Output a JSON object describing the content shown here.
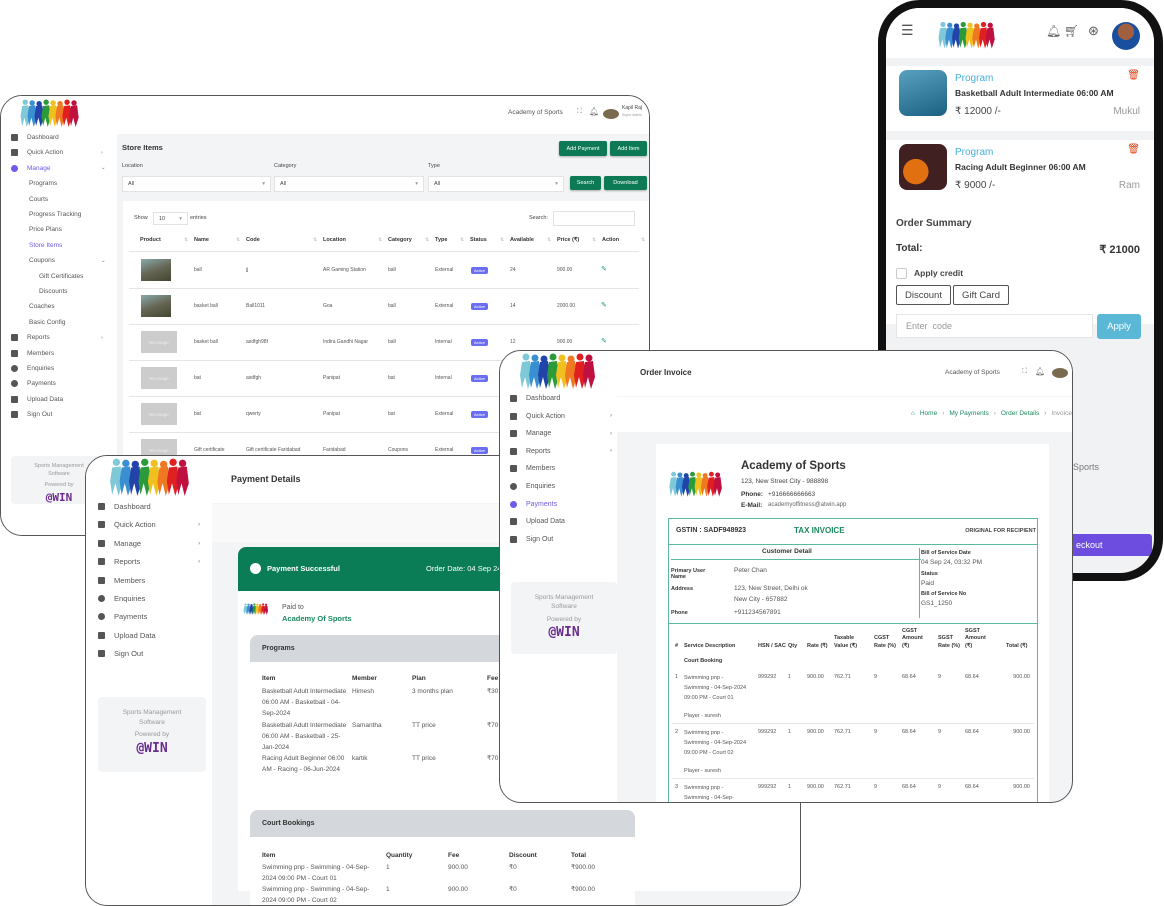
{
  "colors": {
    "brand_green": "#0d7a55",
    "accent_purple": "#6c5ce7",
    "teal": "#4fb3a0",
    "apply_blue": "#5bb7d6",
    "delete_red": "#e0451b"
  },
  "store_window": {
    "org_selector": "Academy of Sports",
    "user_name": "Kapil Raj",
    "user_role": "Super Admin",
    "sidebar": [
      {
        "label": "Dashboard",
        "icon": "dashboard-icon"
      },
      {
        "label": "Quick Action",
        "icon": "bolt-icon",
        "chevron": ">"
      },
      {
        "label": "Manage",
        "icon": "gear-icon",
        "chevron": "v",
        "active": true
      },
      {
        "label": "Programs",
        "sub": 1
      },
      {
        "label": "Courts",
        "sub": 1
      },
      {
        "label": "Progress Tracking",
        "sub": 1
      },
      {
        "label": "Price Plans",
        "sub": 1
      },
      {
        "label": "Store Items",
        "sub": 1,
        "active": true
      },
      {
        "label": "Coupons",
        "sub": 1,
        "chevron": "v"
      },
      {
        "label": "Gift Certificates",
        "sub": 2
      },
      {
        "label": "Discounts",
        "sub": 2
      },
      {
        "label": "Coaches",
        "sub": 1
      },
      {
        "label": "Basic Config",
        "sub": 1
      },
      {
        "label": "Reports",
        "icon": "reports-icon",
        "chevron": ">"
      },
      {
        "label": "Members",
        "icon": "members-icon"
      },
      {
        "label": "Enquiries",
        "icon": "question-icon"
      },
      {
        "label": "Payments",
        "icon": "payments-icon"
      },
      {
        "label": "Upload Data",
        "icon": "database-icon"
      },
      {
        "label": "Sign Out",
        "icon": "sign-out-icon"
      }
    ],
    "footer": {
      "line1": "Sports Management",
      "line2": "Software",
      "powered": "Powered by",
      "brand": "@WIN"
    },
    "title": "Store Items",
    "add_payment": "Add Payment",
    "add_item": "Add Item",
    "filters": [
      {
        "label": "Location",
        "value": "All"
      },
      {
        "label": "Category",
        "value": "All"
      },
      {
        "label": "Type",
        "value": "All"
      }
    ],
    "search_btn": "Search",
    "download_btn": "Download",
    "show": "Show",
    "entries_value": "10",
    "entries": "entries",
    "search_label": "Search:",
    "columns": [
      "Product",
      "Name",
      "Code",
      "Location",
      "Category",
      "Type",
      "Status",
      "Available",
      "Price (₹)",
      "Action"
    ],
    "rows": [
      {
        "img": true,
        "name": "ball",
        "code": "jj",
        "location": "AR Gaming Station",
        "category": "ball",
        "type": "External",
        "status": "Active",
        "available": "24",
        "price": "900.00"
      },
      {
        "img": true,
        "name": "basket ball",
        "code": "Ball1011",
        "location": "Goa",
        "category": "ball",
        "type": "External",
        "status": "Active",
        "available": "14",
        "price": "2000.00"
      },
      {
        "img": false,
        "name": "basket ball",
        "code": "asdfgh98f",
        "location": "Indira Gandhi Nagar",
        "category": "ball",
        "type": "Internal",
        "status": "Active",
        "available": "12",
        "price": "900.00"
      },
      {
        "img": false,
        "name": "bat",
        "code": "asdfgh",
        "location": "Panipat",
        "category": "bat",
        "type": "Internal",
        "status": "Active",
        "available": "",
        "price": ""
      },
      {
        "img": false,
        "name": "bat",
        "code": "qwerty",
        "location": "Panipat",
        "category": "bat",
        "type": "External",
        "status": "Active",
        "available": "",
        "price": ""
      },
      {
        "img": false,
        "name": "Gift certificate",
        "code": "Gift certificate Faridabad",
        "location": "Faridabad",
        "category": "Coupons",
        "type": "External",
        "status": "Active",
        "available": "",
        "price": ""
      }
    ],
    "no_image": "No Image"
  },
  "phone": {
    "cart": [
      {
        "kind": "Program",
        "title": "Basketball Adult Intermediate 06:00 AM",
        "price": "₹ 12000 /-",
        "member": "Mukul"
      },
      {
        "kind": "Program",
        "title": "Racing Adult Beginner 06:00 AM",
        "price": "₹ 9000 /-",
        "member": "Ram"
      }
    ],
    "summary_title": "Order Summary",
    "total_label": "Total:",
    "total_value": "₹ 21000",
    "apply_credit": "Apply credit",
    "discount": "Discount",
    "gift_card": "Gift Card",
    "code_placeholder": "Enter  code",
    "apply": "Apply",
    "checkout": "eckout",
    "peek_text": "y Sports",
    "peek_text2": "d"
  },
  "payment_window": {
    "sidebar": [
      {
        "label": "Dashboard",
        "icon": "dashboard-icon"
      },
      {
        "label": "Quick Action",
        "icon": "bolt-icon",
        "chevron": ">"
      },
      {
        "label": "Manage",
        "icon": "gear-icon",
        "chevron": ">"
      },
      {
        "label": "Reports",
        "icon": "reports-icon",
        "chevron": ">"
      },
      {
        "label": "Members",
        "icon": "members-icon"
      },
      {
        "label": "Enquiries",
        "icon": "question-icon"
      },
      {
        "label": "Payments",
        "icon": "payments-icon"
      },
      {
        "label": "Upload Data",
        "icon": "database-icon"
      },
      {
        "label": "Sign Out",
        "icon": "sign-out-icon"
      }
    ],
    "title": "Payment Details",
    "banner": "Payment Successful",
    "order_date": "Order Date: 04 Sep 24",
    "paid_to": "Paid to",
    "paid_to_name": "Academy Of Sports",
    "programs_title": "Programs",
    "programs_cols": [
      "Item",
      "Member",
      "Plan",
      "Fee"
    ],
    "programs_rows": [
      [
        "Basketball Adult Intermediate 06:00 AM - Basketball - 04-Sep-2024",
        "Himesh",
        "3 months plan",
        "₹30"
      ],
      [
        "Basketball Adult Intermediate 06:00 AM - Basketball - 25-Jan-2024",
        "Samantha",
        "TT price",
        "₹70"
      ],
      [
        "Racing Adult Beginner 06:00 AM - Racing - 06-Jun-2024",
        "kartik",
        "TT price",
        "₹70"
      ]
    ],
    "court_title": "Court Bookings",
    "court_cols": [
      "Item",
      "Quantity",
      "Fee",
      "Discount",
      "Total"
    ],
    "court_rows": [
      [
        "Swimming pnp - Swimming - 04-Sep-2024 09:00 PM - Court 01",
        "1",
        "900.00",
        "₹0",
        "₹900.00"
      ],
      [
        "Swimming pnp - Swimming - 04-Sep-2024 09:00 PM - Court 02",
        "1",
        "900.00",
        "₹0",
        "₹900.00"
      ]
    ]
  },
  "invoice_window": {
    "sidebar": [
      {
        "label": "Dashboard",
        "icon": "dashboard-icon"
      },
      {
        "label": "Quick Action",
        "icon": "bolt-icon",
        "chevron": ">"
      },
      {
        "label": "Manage",
        "icon": "gear-icon",
        "chevron": ">"
      },
      {
        "label": "Reports",
        "icon": "reports-icon",
        "chevron": ">"
      },
      {
        "label": "Members",
        "icon": "members-icon"
      },
      {
        "label": "Enquiries",
        "icon": "question-icon"
      },
      {
        "label": "Payments",
        "icon": "payments-icon",
        "active": true
      },
      {
        "label": "Upload Data",
        "icon": "database-icon"
      },
      {
        "label": "Sign Out",
        "icon": "sign-out-icon"
      }
    ],
    "title": "Order Invoice",
    "org_selector": "Academy of Sports",
    "breadcrumb": [
      "Home",
      "My Payments",
      "Order Details",
      "Invoice"
    ],
    "company": "Academy of Sports",
    "address": "123, New Street City - 988898",
    "phone_label": "Phone:",
    "phone": "+916666666663",
    "email_label": "E-Mail:",
    "email": "academyoffitness@atwin.app",
    "gstin": "GSTIN : SADF948923",
    "tax_invoice": "TAX INVOICE",
    "original": "ORIGINAL FOR RECIPIENT",
    "customer_detail": "Customer Detail",
    "primary_user_label": "Primary User Name",
    "primary_user": "Peter Chan",
    "address_label": "Address",
    "cust_address1": "123, New Street, Delhi ok",
    "cust_address2": "New City  - 657882",
    "cphone_label": "Phone",
    "cphone": "+911234567891",
    "bill_date_label": "Bill of Service Date",
    "bill_date": "04 Sep 24, 03:32 PM",
    "status_label": "Status",
    "status": "Paid",
    "bill_no_label": "Bill of Service No",
    "bill_no": "GS1_1250",
    "columns": [
      "#",
      "Service Description",
      "HSN / SAC",
      "Qty",
      "Rate (₹)",
      "Taxable Value (₹)",
      "CGST Rate (%)",
      "CGST Amount (₹)",
      "SGST Rate (%)",
      "SGST Amount (₹)",
      "Total (₹)"
    ],
    "section": "Court Booking",
    "rows": [
      {
        "n": "1",
        "desc": "Swimming pnp - Swimming - 04-Sep-2024 09:00 PM - Court 01",
        "player": "Player - suresh",
        "hsn": "999292",
        "qty": "1",
        "rate": "900.00",
        "taxable": "762.71",
        "cgst_r": "9",
        "cgst_a": "68.64",
        "sgst_r": "9",
        "sgst_a": "68.64",
        "total": "900.00"
      },
      {
        "n": "2",
        "desc": "Swimming pnp - Swimming - 04-Sep-2024 09:00 PM - Court 02",
        "player": "Player - suresh",
        "hsn": "999292",
        "qty": "1",
        "rate": "900.00",
        "taxable": "762.71",
        "cgst_r": "9",
        "cgst_a": "68.64",
        "sgst_r": "9",
        "sgst_a": "68.64",
        "total": "900.00"
      },
      {
        "n": "3",
        "desc": "Swimming pnp - Swimming - 04-Sep-",
        "player": "",
        "hsn": "999292",
        "qty": "1",
        "rate": "900.00",
        "taxable": "762.71",
        "cgst_r": "9",
        "cgst_a": "68.64",
        "sgst_r": "9",
        "sgst_a": "68.64",
        "total": "900.00"
      }
    ]
  }
}
